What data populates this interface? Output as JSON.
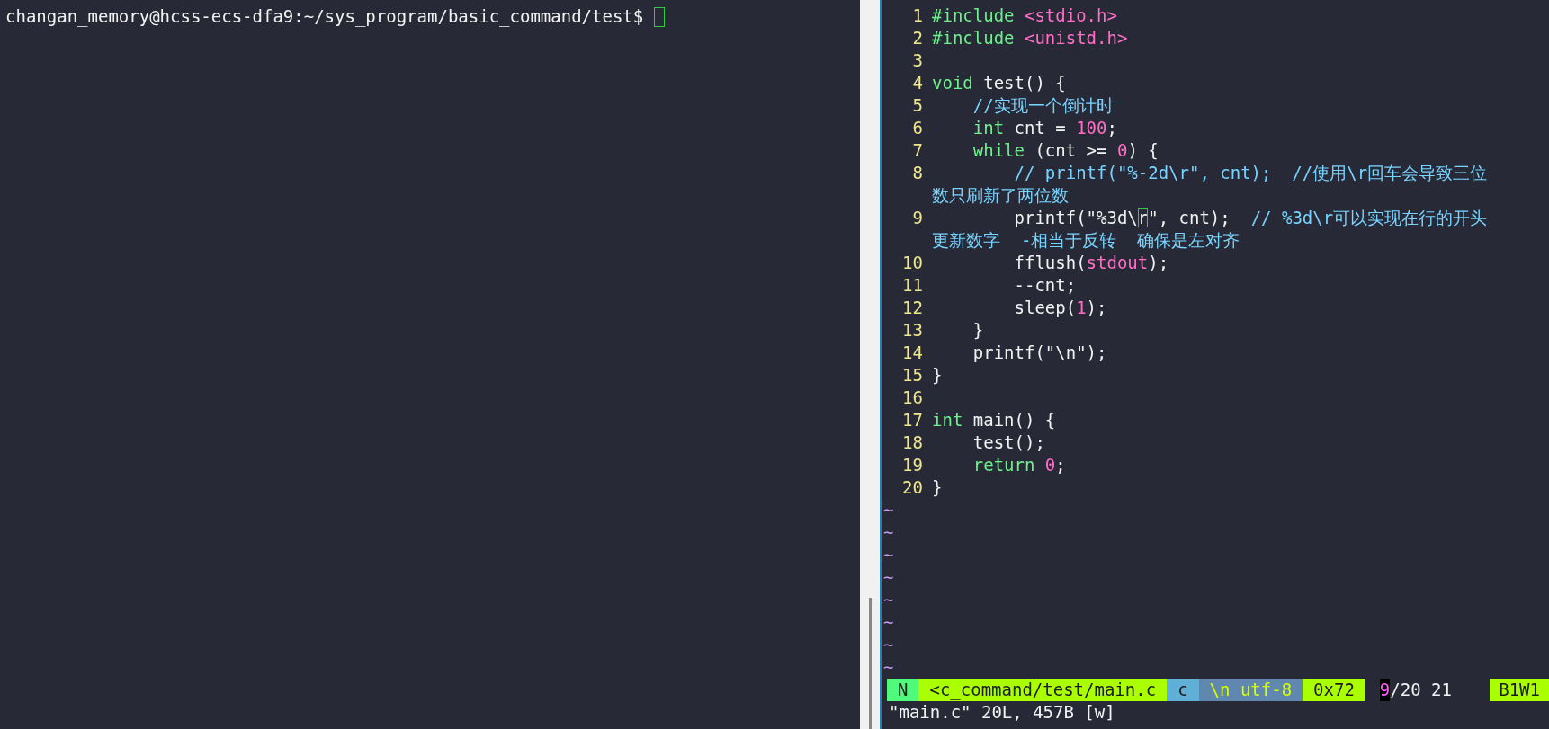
{
  "terminal": {
    "prompt": "changan_memory@hcss-ecs-dfa9:~/sys_program/basic_command/test$"
  },
  "editor": {
    "lines": [
      {
        "number": "1",
        "rows": [
          [
            {
              "kind": "keyword",
              "text": "#include"
            },
            {
              "kind": "plain",
              "text": " "
            },
            {
              "kind": "constant",
              "text": "<stdio.h>"
            }
          ]
        ]
      },
      {
        "number": "2",
        "rows": [
          [
            {
              "kind": "keyword",
              "text": "#include"
            },
            {
              "kind": "plain",
              "text": " "
            },
            {
              "kind": "constant",
              "text": "<unistd.h>"
            }
          ]
        ]
      },
      {
        "number": "3",
        "rows": [
          []
        ]
      },
      {
        "number": "4",
        "rows": [
          [
            {
              "kind": "keyword",
              "text": "void"
            },
            {
              "kind": "plain",
              "text": " test() {"
            }
          ]
        ]
      },
      {
        "number": "5",
        "rows": [
          [
            {
              "kind": "plain",
              "text": "    "
            },
            {
              "kind": "comment",
              "text": "//实现一个倒计时"
            }
          ]
        ]
      },
      {
        "number": "6",
        "rows": [
          [
            {
              "kind": "plain",
              "text": "    "
            },
            {
              "kind": "keyword",
              "text": "int"
            },
            {
              "kind": "plain",
              "text": " cnt = "
            },
            {
              "kind": "constant",
              "text": "100"
            },
            {
              "kind": "plain",
              "text": ";"
            }
          ]
        ]
      },
      {
        "number": "7",
        "rows": [
          [
            {
              "kind": "plain",
              "text": "    "
            },
            {
              "kind": "keyword",
              "text": "while"
            },
            {
              "kind": "plain",
              "text": " (cnt >= "
            },
            {
              "kind": "constant",
              "text": "0"
            },
            {
              "kind": "plain",
              "text": ") {"
            }
          ]
        ]
      },
      {
        "number": "8",
        "rows": [
          [
            {
              "kind": "plain",
              "text": "        "
            },
            {
              "kind": "comment",
              "text": "// printf(\"%-2d\\r\", cnt);  //使用\\r回车会导致三位"
            }
          ],
          [
            {
              "kind": "comment",
              "text": "数只刷新了两位数"
            }
          ]
        ]
      },
      {
        "number": "9",
        "rows": [
          [
            {
              "kind": "plain",
              "text": "        printf(\"%3d\\"
            },
            {
              "kind": "cursor",
              "text": "r"
            },
            {
              "kind": "plain",
              "text": "\", cnt);  "
            },
            {
              "kind": "comment",
              "text": "// %3d\\r可以实现在行的开头"
            }
          ],
          [
            {
              "kind": "comment",
              "text": "更新数字  -相当于反转  确保是左对齐"
            }
          ]
        ]
      },
      {
        "number": "10",
        "rows": [
          [
            {
              "kind": "plain",
              "text": "        fflush("
            },
            {
              "kind": "constant",
              "text": "stdout"
            },
            {
              "kind": "plain",
              "text": ");"
            }
          ]
        ]
      },
      {
        "number": "11",
        "rows": [
          [
            {
              "kind": "plain",
              "text": "        --cnt;"
            }
          ]
        ]
      },
      {
        "number": "12",
        "rows": [
          [
            {
              "kind": "plain",
              "text": "        sleep("
            },
            {
              "kind": "constant",
              "text": "1"
            },
            {
              "kind": "plain",
              "text": ");"
            }
          ]
        ]
      },
      {
        "number": "13",
        "rows": [
          [
            {
              "kind": "plain",
              "text": "    }"
            }
          ]
        ]
      },
      {
        "number": "14",
        "rows": [
          [
            {
              "kind": "plain",
              "text": "    printf(\"\\n\");"
            }
          ]
        ]
      },
      {
        "number": "15",
        "rows": [
          [
            {
              "kind": "plain",
              "text": "}"
            }
          ]
        ]
      },
      {
        "number": "16",
        "rows": [
          []
        ]
      },
      {
        "number": "17",
        "rows": [
          [
            {
              "kind": "keyword",
              "text": "int"
            },
            {
              "kind": "plain",
              "text": " main() {"
            }
          ]
        ]
      },
      {
        "number": "18",
        "rows": [
          [
            {
              "kind": "plain",
              "text": "    test();"
            }
          ]
        ]
      },
      {
        "number": "19",
        "rows": [
          [
            {
              "kind": "plain",
              "text": "    "
            },
            {
              "kind": "keyword",
              "text": "return"
            },
            {
              "kind": "plain",
              "text": " "
            },
            {
              "kind": "constant",
              "text": "0"
            },
            {
              "kind": "plain",
              "text": ";"
            }
          ]
        ]
      },
      {
        "number": "20",
        "rows": [
          [
            {
              "kind": "plain",
              "text": "}"
            }
          ]
        ]
      }
    ],
    "tildes": [
      "~",
      "~",
      "~",
      "~",
      "~",
      "~",
      "~",
      "~"
    ],
    "status_bar": [
      {
        "kind": "mode",
        "text": "N"
      },
      {
        "kind": "file",
        "text": "<c_command/test/main.c"
      },
      {
        "kind": "filetype",
        "text": "c"
      },
      {
        "kind": "encoding",
        "text": "\\n utf-8"
      },
      {
        "kind": "hex",
        "text": "0x72"
      },
      {
        "kind": "linecur",
        "text": "9"
      },
      {
        "kind": "position",
        "text": "/20 21"
      },
      {
        "kind": "buffer",
        "text": "B1W1"
      }
    ],
    "message": "\"main.c\" 20L, 457B [w]"
  }
}
